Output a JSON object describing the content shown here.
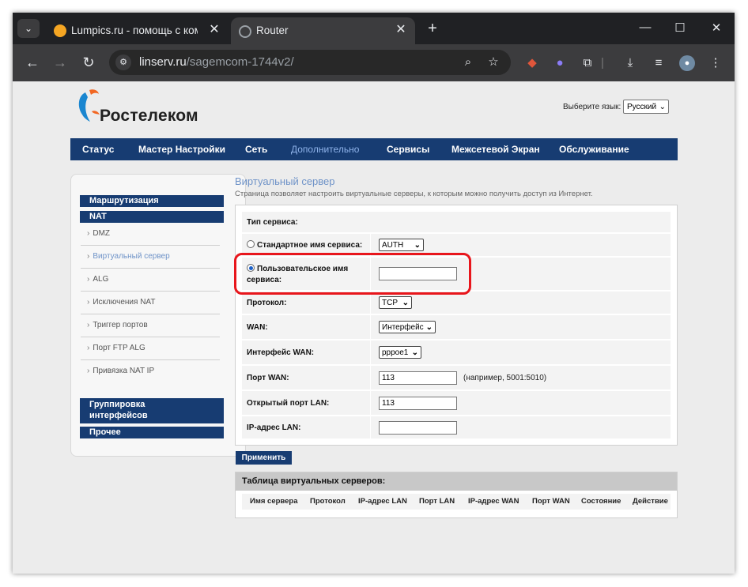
{
  "browser": {
    "tabs": [
      {
        "title": "Lumpics.ru - помощь с компь",
        "favicon_color": "#f5a623"
      },
      {
        "title": "Router",
        "favicon_color": "#9aa0a6"
      }
    ],
    "url_domain": "linserv.ru",
    "url_path": "/sagemcom-1744v2/"
  },
  "header": {
    "brand": "Ростелеком",
    "lang_label": "Выберите язык:",
    "lang_value": "Русский"
  },
  "nav": [
    "Статус",
    "Мастер Настройки",
    "Сеть",
    "Дополнительно",
    "Сервисы",
    "Межсетевой Экран",
    "Обслуживание"
  ],
  "sidebar": {
    "routing": "Маршрутизация",
    "nat": "NAT",
    "items": [
      "DMZ",
      "Виртуальный сервер",
      "ALG",
      "Исключения NAT",
      "Триггер портов",
      "Порт FTP ALG",
      "Привязка NAT IP"
    ],
    "grouping_line1": "Группировка",
    "grouping_line2": "интерфейсов",
    "other": "Прочее"
  },
  "page": {
    "title": "Виртуальный сервер",
    "description": "Страница позволяет настроить виртуальные серверы, к которым можно получить доступ из Интернет."
  },
  "form": {
    "service_type_label": "Тип сервиса:",
    "standard_label": "Стандартное имя сервиса:",
    "standard_value": "AUTH",
    "custom_label_line1": "Пользовательское имя",
    "custom_label_line2": "сервиса:",
    "custom_value": "",
    "protocol_label": "Протокол:",
    "protocol_value": "TCP",
    "wan_label": "WAN:",
    "wan_value": "Интерфейс",
    "wan_iface_label": "Интерфейс WAN:",
    "wan_iface_value": "pppoe1",
    "wan_port_label": "Порт WAN:",
    "wan_port_value": "113",
    "wan_port_hint": "(например, 5001:5010)",
    "lan_port_label": "Открытый порт LAN:",
    "lan_port_value": "113",
    "lan_ip_label": "IP-адрес LAN:",
    "lan_ip_value": "",
    "apply": "Применить"
  },
  "table": {
    "title": "Таблица виртуальных серверов:",
    "columns": [
      "Имя сервера",
      "Протокол",
      "IP-адрес LAN",
      "Порт LAN",
      "IP-адрес WAN",
      "Порт WAN",
      "Состояние",
      "Действие"
    ]
  },
  "colors": {
    "nav_bg": "#173c72",
    "accent_link": "#6f93c8",
    "highlight": "#e8161c"
  }
}
